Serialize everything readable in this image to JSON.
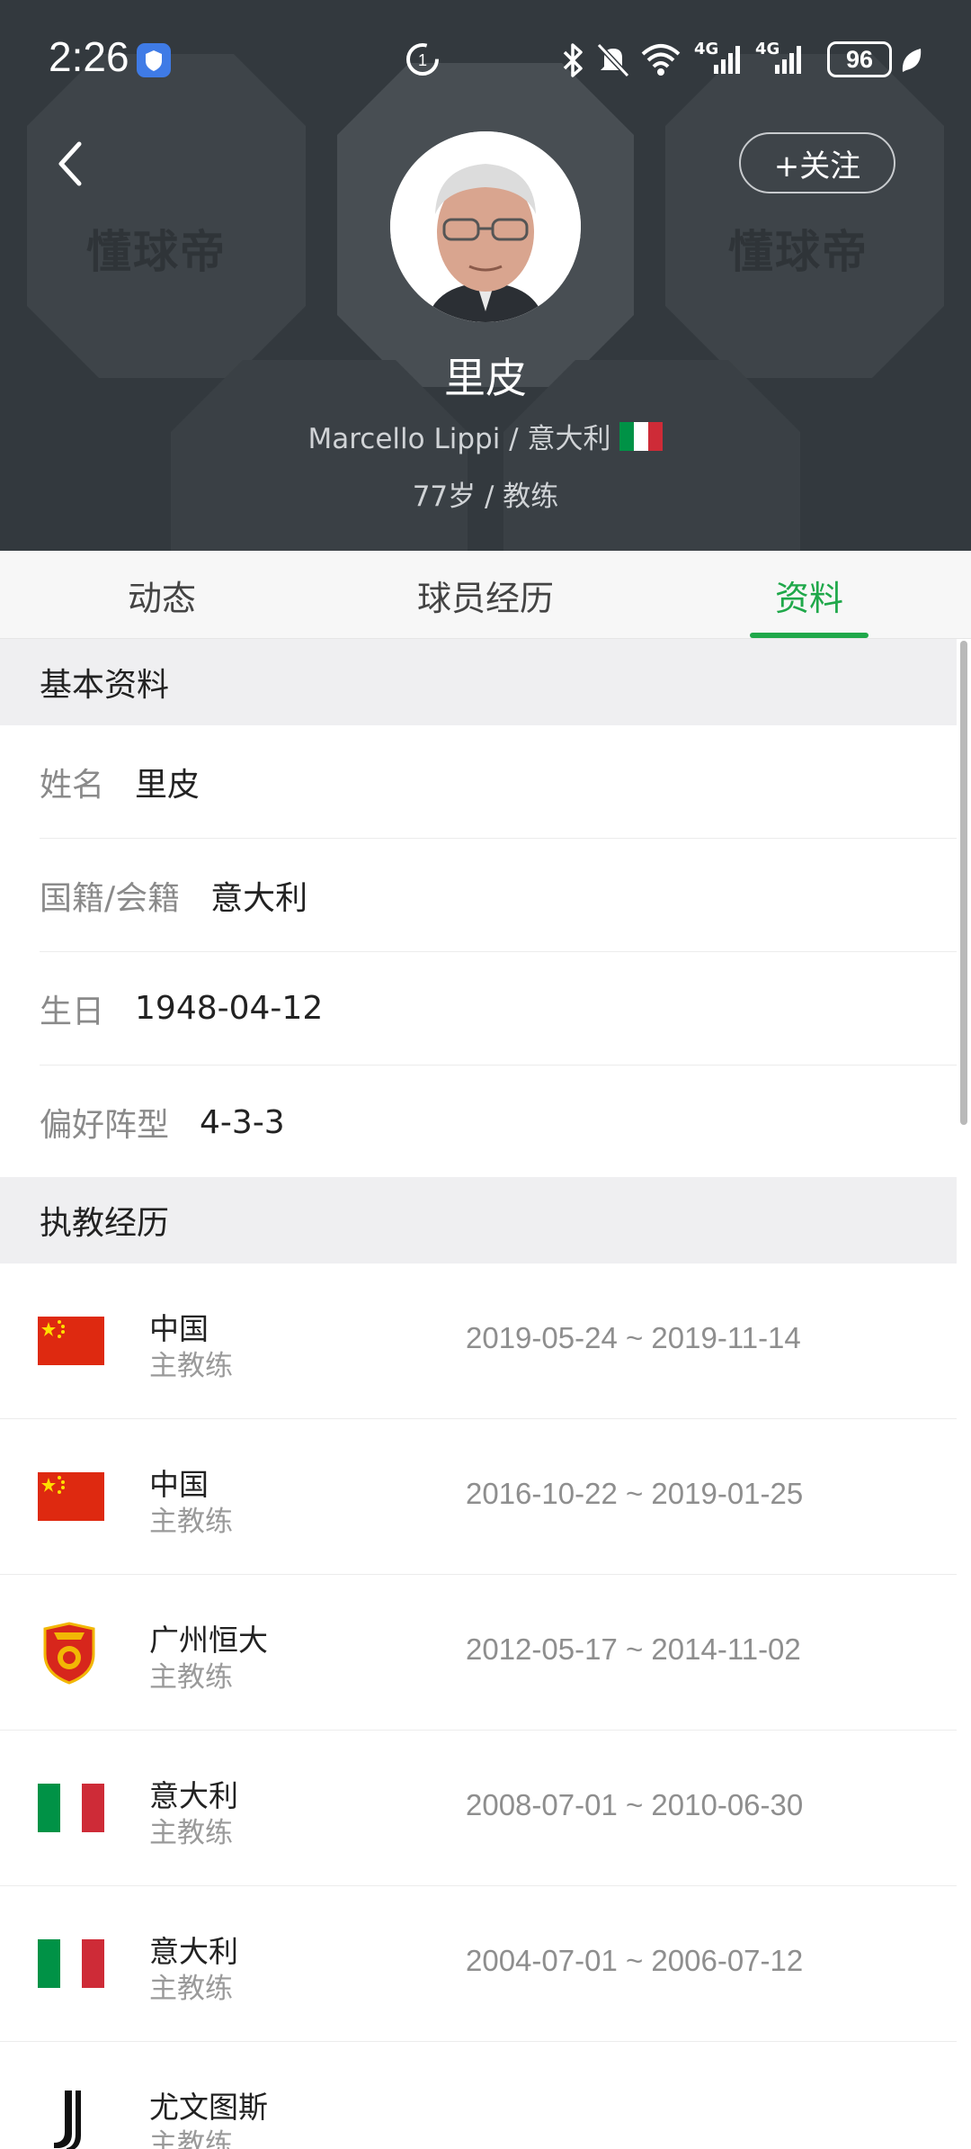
{
  "status_bar": {
    "time": "2:26",
    "battery": "96",
    "network_1": "4G",
    "network_2": "4G",
    "icons": [
      "app-shield-icon",
      "data-saver-icon",
      "bluetooth-icon",
      "mute-icon",
      "wifi-icon",
      "signal-icon",
      "battery-icon",
      "leaf-icon"
    ]
  },
  "header": {
    "watermark": "懂球帝",
    "follow_label": "+关注",
    "name": "里皮",
    "english_name_nation": "Marcello Lippi / 意大利",
    "age_role": "77岁 / 教练"
  },
  "tabs": [
    {
      "label": "动态",
      "active": false
    },
    {
      "label": "球员经历",
      "active": false
    },
    {
      "label": "资料",
      "active": true
    }
  ],
  "basic_info": {
    "title": "基本资料",
    "rows": [
      {
        "label": "姓名",
        "value": "里皮"
      },
      {
        "label": "国籍/会籍",
        "value": "意大利"
      },
      {
        "label": "生日",
        "value": "1948-04-12"
      },
      {
        "label": "偏好阵型",
        "value": "4-3-3"
      }
    ]
  },
  "coaching": {
    "title": "执教经历",
    "rows": [
      {
        "team": "中国",
        "role": "主教练",
        "period": "2019-05-24 ~ 2019-11-14",
        "logo": "china-flag-icon"
      },
      {
        "team": "中国",
        "role": "主教练",
        "period": "2016-10-22 ~ 2019-01-25",
        "logo": "china-flag-icon"
      },
      {
        "team": "广州恒大",
        "role": "主教练",
        "period": "2012-05-17 ~ 2014-11-02",
        "logo": "guangzhou-evergrande-crest-icon"
      },
      {
        "team": "意大利",
        "role": "主教练",
        "period": "2008-07-01 ~ 2010-06-30",
        "logo": "italy-flag-icon"
      },
      {
        "team": "意大利",
        "role": "主教练",
        "period": "2004-07-01 ~ 2006-07-12",
        "logo": "italy-flag-icon"
      },
      {
        "team": "尤文图斯",
        "role": "主教练",
        "period": "",
        "logo": "juventus-logo-icon"
      }
    ]
  },
  "colors": {
    "header_bg": "#33393e",
    "accent": "#1fa84a",
    "china_red": "#de2910",
    "china_yellow": "#ffde00",
    "italy_green": "#009246",
    "italy_red": "#ce2b37"
  }
}
